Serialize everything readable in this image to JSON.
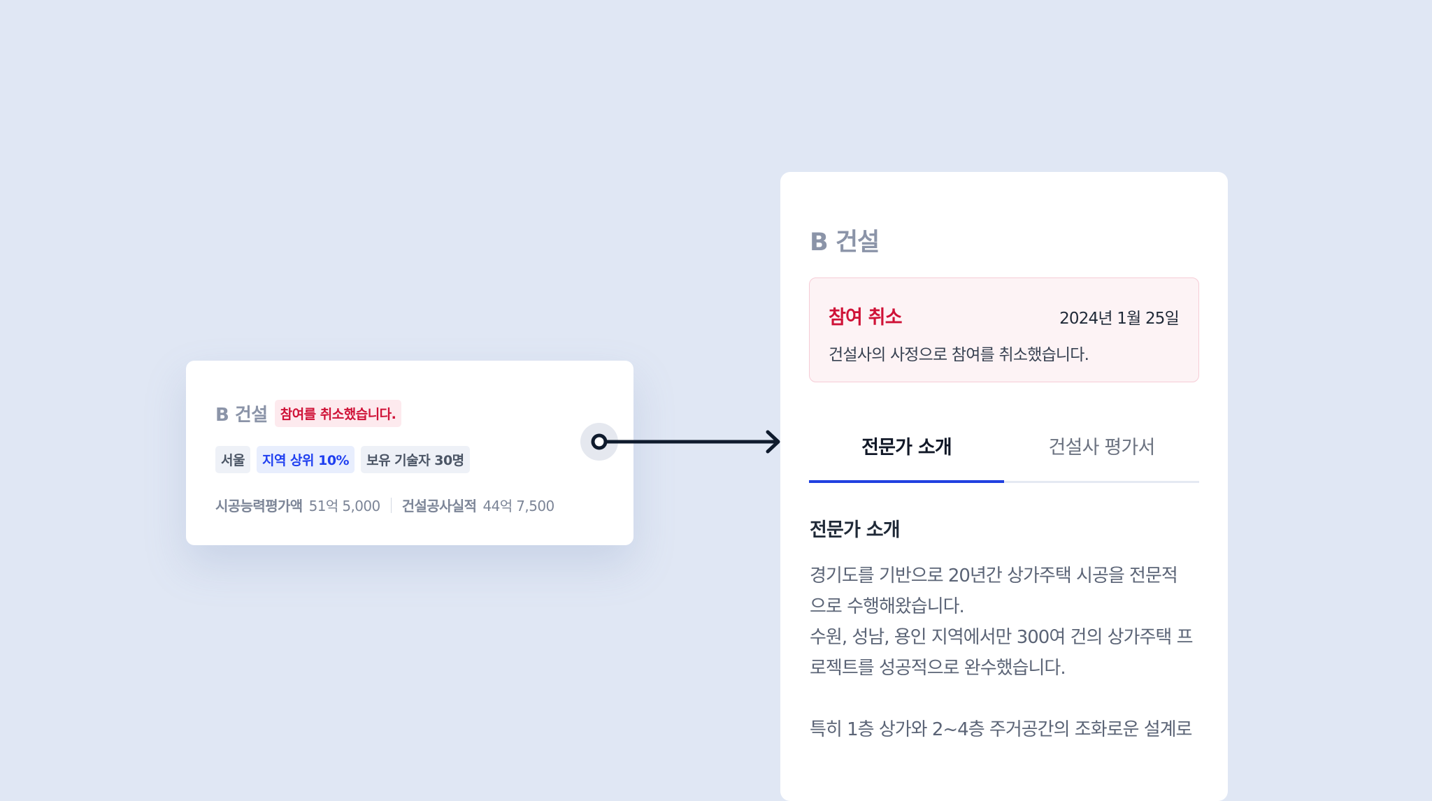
{
  "summary_card": {
    "company": "B 건설",
    "status_badge": "참여를 취소했습니다.",
    "tags": {
      "region": "서울",
      "rank": "지역 상위 10%",
      "engineers": "보유 기술자 30명"
    },
    "stats": {
      "capability_label": "시공능력평가액",
      "capability_value": "51억 5,000",
      "record_label": "건설공사실적",
      "record_value": "44억 7,500"
    }
  },
  "detail_panel": {
    "company": "B 건설",
    "notice": {
      "title": "참여 취소",
      "date": "2024년 1월 25일",
      "message": "건설사의 사정으로 참여를 취소했습니다."
    },
    "tabs": {
      "expert_intro": "전문가 소개",
      "evaluation": "건설사 평가서"
    },
    "section": {
      "heading": "전문가 소개",
      "line1": "경기도를 기반으로 20년간 상가주택 시공을 전문적",
      "line2": "으로 수행해왔습니다.",
      "line3": "수원, 성남, 용인 지역에서만 300여 건의 상가주택 프",
      "line4": "로젝트를 성공적으로 완수했습니다.",
      "line5": "특히 1층 상가와 2~4층 주거공간의 조화로운 설계로"
    }
  },
  "colors": {
    "background": "#e0e7f4",
    "danger": "#cf1237",
    "accent_blue": "#2141e0",
    "connector": "#0f1b2d"
  }
}
